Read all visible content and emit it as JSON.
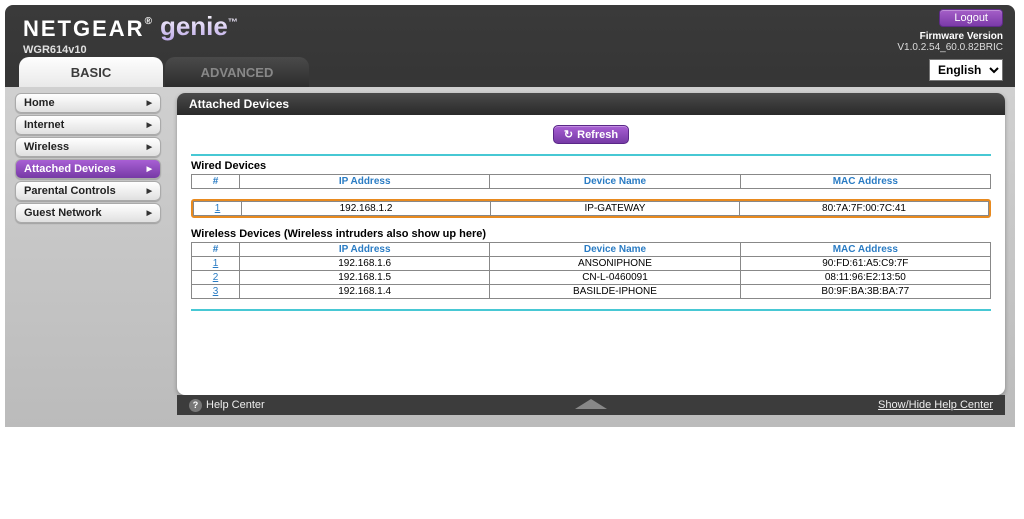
{
  "brand": {
    "netgear": "NETGEAR",
    "genie": "genie"
  },
  "model": "WGR614v10",
  "logout": "Logout",
  "firmware": {
    "label": "Firmware Version",
    "value": "V1.0.2.54_60.0.82BRIC"
  },
  "tabs": {
    "basic": "BASIC",
    "advanced": "ADVANCED"
  },
  "language": {
    "options": [
      "English"
    ],
    "selected": "English"
  },
  "sidebar": {
    "items": [
      {
        "label": "Home"
      },
      {
        "label": "Internet"
      },
      {
        "label": "Wireless"
      },
      {
        "label": "Attached Devices",
        "active": true
      },
      {
        "label": "Parental Controls"
      },
      {
        "label": "Guest Network"
      }
    ]
  },
  "panel": {
    "title": "Attached Devices",
    "refresh": "Refresh",
    "wired_heading": "Wired Devices",
    "wireless_heading": "Wireless Devices (Wireless intruders also show up here)",
    "cols": {
      "num": "#",
      "ip": "IP Address",
      "name": "Device Name",
      "mac": "MAC Address"
    },
    "wired": [
      {
        "idx": "1",
        "ip": "192.168.1.2",
        "name": "IP-GATEWAY",
        "mac": "80:7A:7F:00:7C:41"
      }
    ],
    "wireless": [
      {
        "idx": "1",
        "ip": "192.168.1.6",
        "name": "ANSONIPHONE",
        "mac": "90:FD:61:A5:C9:7F"
      },
      {
        "idx": "2",
        "ip": "192.168.1.5",
        "name": "CN-L-0460091",
        "mac": "08:11:96:E2:13:50"
      },
      {
        "idx": "3",
        "ip": "192.168.1.4",
        "name": "BASILDE-IPHONE",
        "mac": "B0:9F:BA:3B:BA:77"
      }
    ]
  },
  "helpbar": {
    "left": "Help Center",
    "right": "Show/Hide Help Center"
  }
}
